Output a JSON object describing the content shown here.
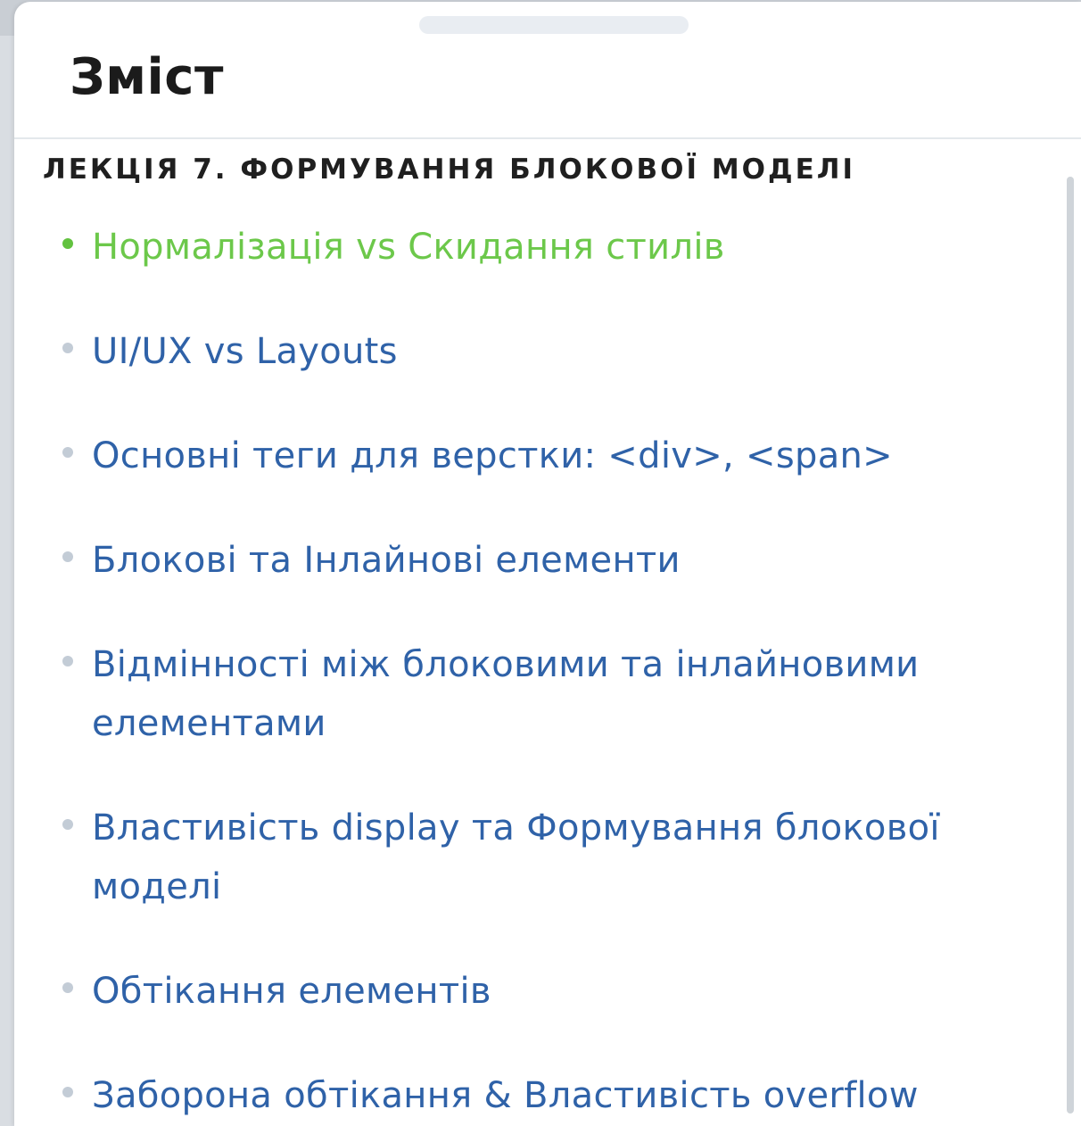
{
  "sheet": {
    "title": "Зміст"
  },
  "toc": {
    "section_heading": "ЛЕКЦІЯ 7. ФОРМУВАННЯ БЛОКОВОЇ МОДЕЛІ",
    "items": [
      {
        "label": "Нормалізація vs Скидання стилів",
        "active": true
      },
      {
        "label": "UI/UX vs Layouts",
        "active": false
      },
      {
        "label": "Основні теги для верстки: <div>, <span>",
        "active": false
      },
      {
        "label": "Блокові та Інлайнові елементи",
        "active": false
      },
      {
        "label": "Відмінності між блоковими та інлайновими елементами",
        "active": false
      },
      {
        "label": "Властивість display та Формування блокової моделі",
        "active": false
      },
      {
        "label": "Обтікання елементів",
        "active": false
      },
      {
        "label": "Заборона обтікання & Властивість overflow",
        "active": false
      }
    ]
  },
  "colors": {
    "active_link": "#6cc84a",
    "link": "#2f62a8",
    "heading": "#1f1f1f"
  }
}
